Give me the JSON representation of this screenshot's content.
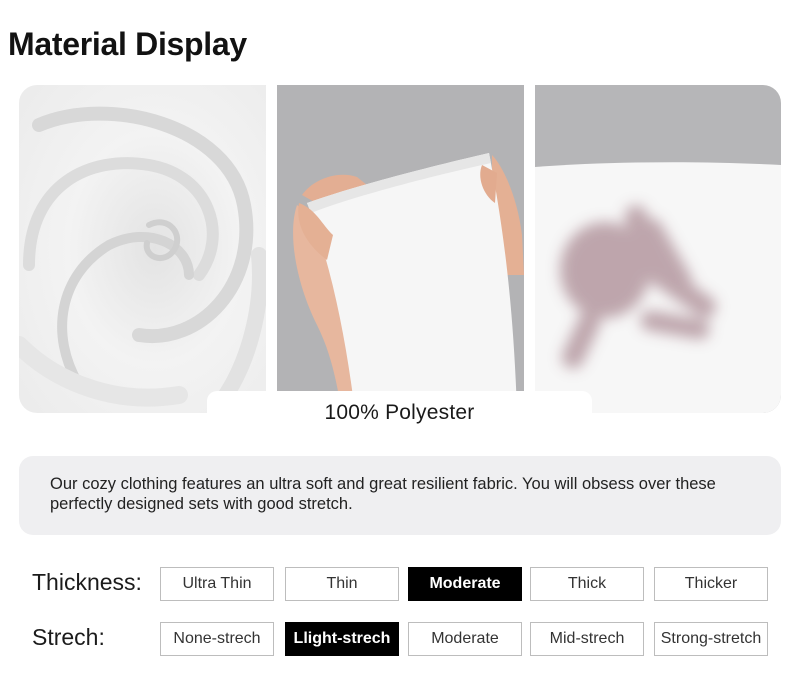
{
  "page": {
    "title": "Material Display"
  },
  "gallery": {
    "photos": [
      {
        "icon": "fabric-swirl-image",
        "subject": "white fabric swirl"
      },
      {
        "icon": "fabric-stretch-hands-image",
        "subject": "hands stretching white fabric"
      },
      {
        "icon": "hand-behind-fabric-image",
        "subject": "hand silhouette behind translucent fabric"
      }
    ],
    "caption": "100% Polyester"
  },
  "description": {
    "text": "Our cozy clothing features an ultra soft and great resilient fabric. You will obsess over these perfectly designed sets with good stretch."
  },
  "specs": {
    "thickness": {
      "label": "Thickness:",
      "options": [
        "Ultra Thin",
        "Thin",
        "Moderate",
        "Thick",
        "Thicker"
      ],
      "selected": "Moderate"
    },
    "stretch": {
      "label": "Strech:",
      "options": [
        "None-strech",
        "Llight-strech",
        "Moderate",
        "Mid-strech",
        "Strong-stretch"
      ],
      "selected": "Llight-strech"
    }
  },
  "colors": {
    "selected_bg": "#000000",
    "card_bg": "#efeff1",
    "photo_backdrop": "#b4b4b6"
  }
}
